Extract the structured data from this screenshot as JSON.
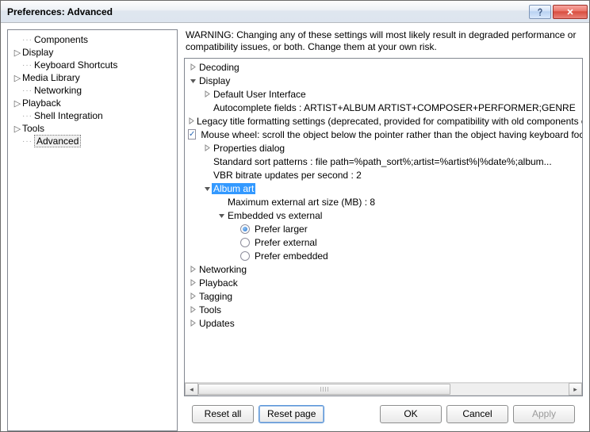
{
  "window": {
    "title": "Preferences: Advanced"
  },
  "sidebar": {
    "items": [
      {
        "label": "Components",
        "expandable": false,
        "depth": 0
      },
      {
        "label": "Display",
        "expandable": true,
        "depth": 0
      },
      {
        "label": "Keyboard Shortcuts",
        "expandable": false,
        "depth": 0
      },
      {
        "label": "Media Library",
        "expandable": true,
        "depth": 0
      },
      {
        "label": "Networking",
        "expandable": false,
        "depth": 0
      },
      {
        "label": "Playback",
        "expandable": true,
        "depth": 0
      },
      {
        "label": "Shell Integration",
        "expandable": false,
        "depth": 0
      },
      {
        "label": "Tools",
        "expandable": true,
        "depth": 0
      },
      {
        "label": "Advanced",
        "expandable": false,
        "depth": 0,
        "selected": true
      }
    ]
  },
  "main": {
    "warning": "WARNING: Changing any of these settings will most likely result in degraded performance or compatibility issues, or both. Change them at your own risk."
  },
  "tree": {
    "decoding": "Decoding",
    "display": "Display",
    "default_ui": "Default User Interface",
    "autocomplete": "Autocomplete fields : ARTIST+ALBUM ARTIST+COMPOSER+PERFORMER;GENRE",
    "legacy": "Legacy title formatting settings (deprecated, provided for compatibility with old components only)",
    "mouse_wheel": "Mouse wheel: scroll the object below the pointer rather than the object having keyboard focus",
    "properties": "Properties dialog",
    "sort_patterns": "Standard sort patterns : file path=%path_sort%;artist=%artist%|%date%;album...",
    "vbr": "VBR bitrate updates per second : 2",
    "album_art": "Album art",
    "max_ext": "Maximum external art size (MB) : 8",
    "embedded_vs": "Embedded vs external",
    "prefer_larger": "Prefer larger",
    "prefer_external": "Prefer external",
    "prefer_embedded": "Prefer embedded",
    "networking": "Networking",
    "playback": "Playback",
    "tagging": "Tagging",
    "tools": "Tools",
    "updates": "Updates"
  },
  "buttons": {
    "reset_all": "Reset all",
    "reset_page": "Reset page",
    "ok": "OK",
    "cancel": "Cancel",
    "apply": "Apply"
  }
}
